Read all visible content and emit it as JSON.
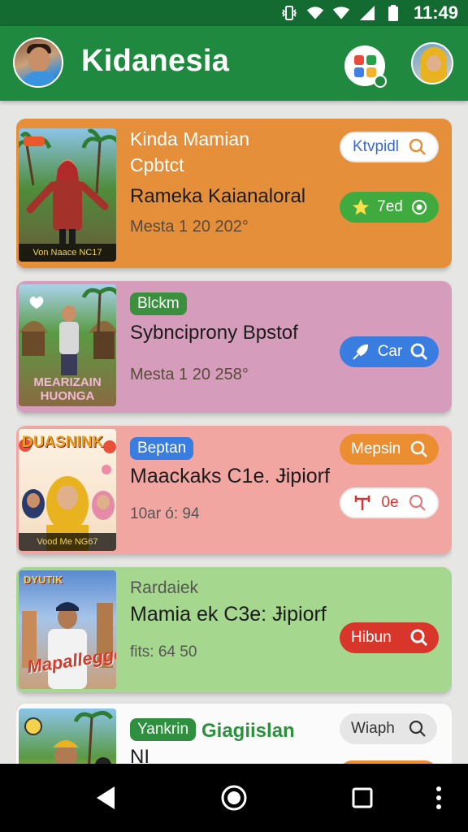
{
  "status_bar": {
    "time": "11:49",
    "icons": [
      "vibrate-icon",
      "wifi-icon",
      "signal-icon",
      "battery-icon"
    ]
  },
  "app_bar": {
    "title": "Kidanesia",
    "icons": [
      "profile-avatar",
      "apps-grid-icon",
      "user-avatar"
    ],
    "apps_colors": [
      "#e84a3c",
      "#27a047",
      "#3f7fe6",
      "#f3b22b"
    ]
  },
  "colors": {
    "app_green": "#1f8a3f",
    "card_orange": "#e58f3a",
    "card_pink": "#d59cbb",
    "card_salmon": "#f2a6a2",
    "card_green": "#a6d78e",
    "card_white": "#fbfbfb"
  },
  "cards": [
    {
      "subtitle_lines": [
        "Kinda Mamian",
        "Cpbtct"
      ],
      "title": "Rameka Kaianaloral",
      "date": "Mesta 1 20 202°",
      "thumb_caption": "Von Naace NC17",
      "pills": [
        {
          "label": "Ktvpidl",
          "icon": "search-icon"
        },
        {
          "label": "7ed",
          "icon": "star-icon",
          "icon2": "radio-icon"
        }
      ]
    },
    {
      "tag": "Blckm",
      "title": "Sybncipronу Bpstof",
      "date": "Mesta 1 20 258°",
      "thumb_caption": "MEARIZAIN HUONGA",
      "pills": [
        {
          "label": "Car",
          "icon": "rocket-icon",
          "icon2": "search-icon"
        }
      ]
    },
    {
      "tag": "Beptan",
      "title": "Maackaks C1e. Ɉipiorf",
      "meta": "10ar ó: 94",
      "thumb_caption": "Vood Me NG67",
      "thumb_title": "DUASNINK",
      "pills": [
        {
          "label": "Mepsin",
          "icon": "search-icon"
        },
        {
          "label": "0e",
          "icon": "hammer-icon",
          "icon2": "search-icon"
        }
      ]
    },
    {
      "subtitle": "Rardaiek",
      "title": "Mamia ek C3e: Ɉipiorf",
      "meta": "fits: 64 50",
      "thumb_title": "DYUTIK",
      "thumb_script": "Mapallegge",
      "pills": [
        {
          "label": "Hibun",
          "icon": "search-icon"
        }
      ]
    },
    {
      "tag": "Yankrin",
      "heading": "Giagiislan",
      "title": "NI",
      "pills": [
        {
          "label": "Wiaph",
          "icon": "search-icon"
        }
      ]
    }
  ],
  "nav_bar": {
    "buttons": [
      "back-button",
      "home-button",
      "recents-button",
      "menu-button"
    ]
  }
}
